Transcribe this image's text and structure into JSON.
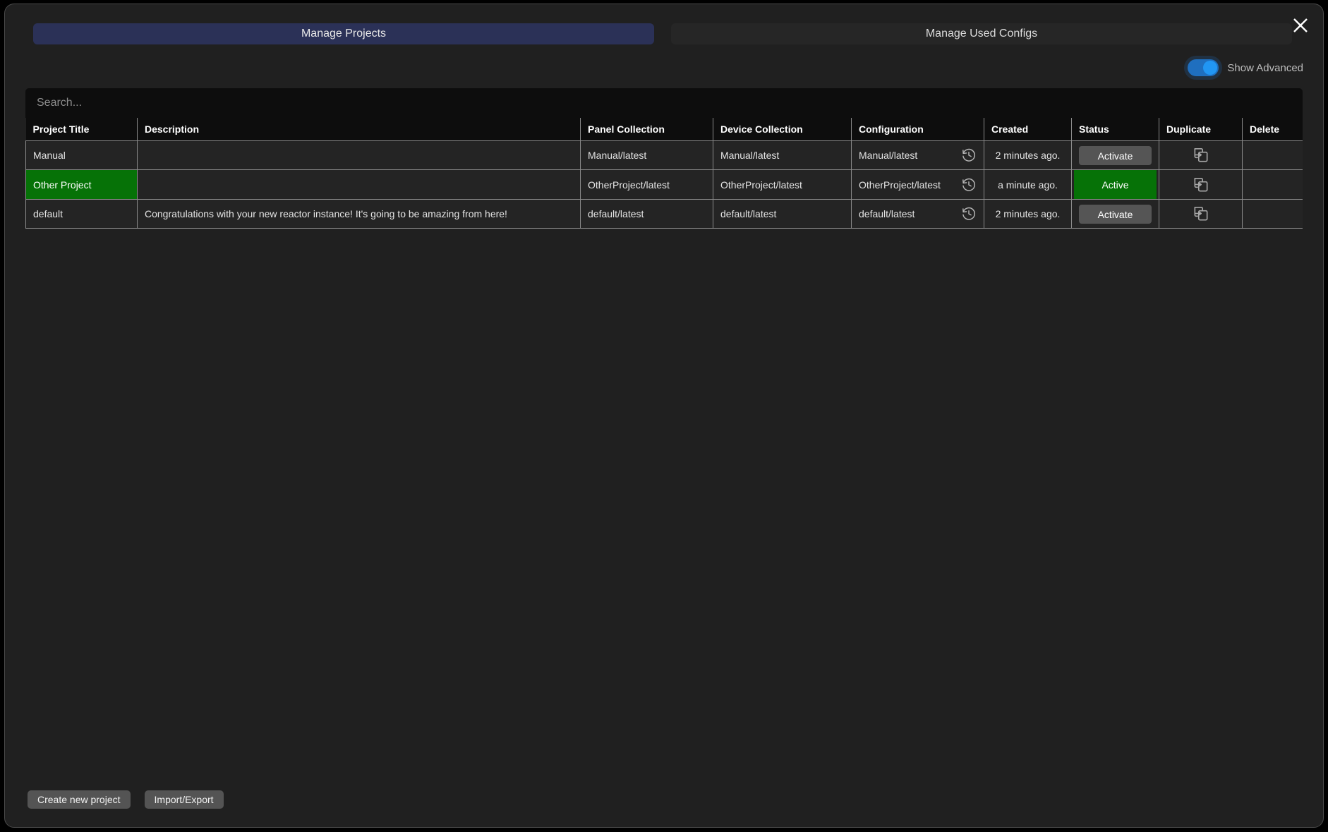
{
  "window": {
    "close_icon": "close-icon"
  },
  "tabs": [
    {
      "label": "Manage Projects",
      "active": true
    },
    {
      "label": "Manage Used Configs",
      "active": false
    }
  ],
  "advanced_toggle": {
    "label": "Show Advanced",
    "state": "on",
    "accent_color": "#2196f3"
  },
  "search": {
    "placeholder": "Search...",
    "value": ""
  },
  "table": {
    "columns": [
      "Project Title",
      "Description",
      "Panel Collection",
      "Device Collection",
      "Configuration",
      "Created",
      "Status",
      "Duplicate",
      "Delete"
    ],
    "rows": [
      {
        "title": "Manual",
        "description": "",
        "panel_collection": "Manual/latest",
        "device_collection": "Manual/latest",
        "configuration": "Manual/latest",
        "config_history_icon": "history-icon",
        "created": "2 minutes ago.",
        "status_label": "Activate",
        "status_active": false,
        "duplicate_icon": "duplicate-icon",
        "delete": ""
      },
      {
        "title": "Other Project",
        "description": "",
        "panel_collection": "OtherProject/latest",
        "device_collection": "OtherProject/latest",
        "configuration": "OtherProject/latest",
        "config_history_icon": "history-icon",
        "created": "a minute ago.",
        "status_label": "Active",
        "status_active": true,
        "duplicate_icon": "duplicate-icon",
        "delete": ""
      },
      {
        "title": "default",
        "description": "Congratulations with your new reactor instance! It's going to be amazing from here!",
        "panel_collection": "default/latest",
        "device_collection": "default/latest",
        "configuration": "default/latest",
        "config_history_icon": "history-icon",
        "created": "2 minutes ago.",
        "status_label": "Activate",
        "status_active": false,
        "duplicate_icon": "duplicate-icon",
        "delete": ""
      }
    ]
  },
  "footer": {
    "create_label": "Create new project",
    "import_export_label": "Import/Export"
  },
  "colors": {
    "active_green": "#067207",
    "tab_active_blue": "#2b3157",
    "toggle_blue": "#2196f3"
  }
}
